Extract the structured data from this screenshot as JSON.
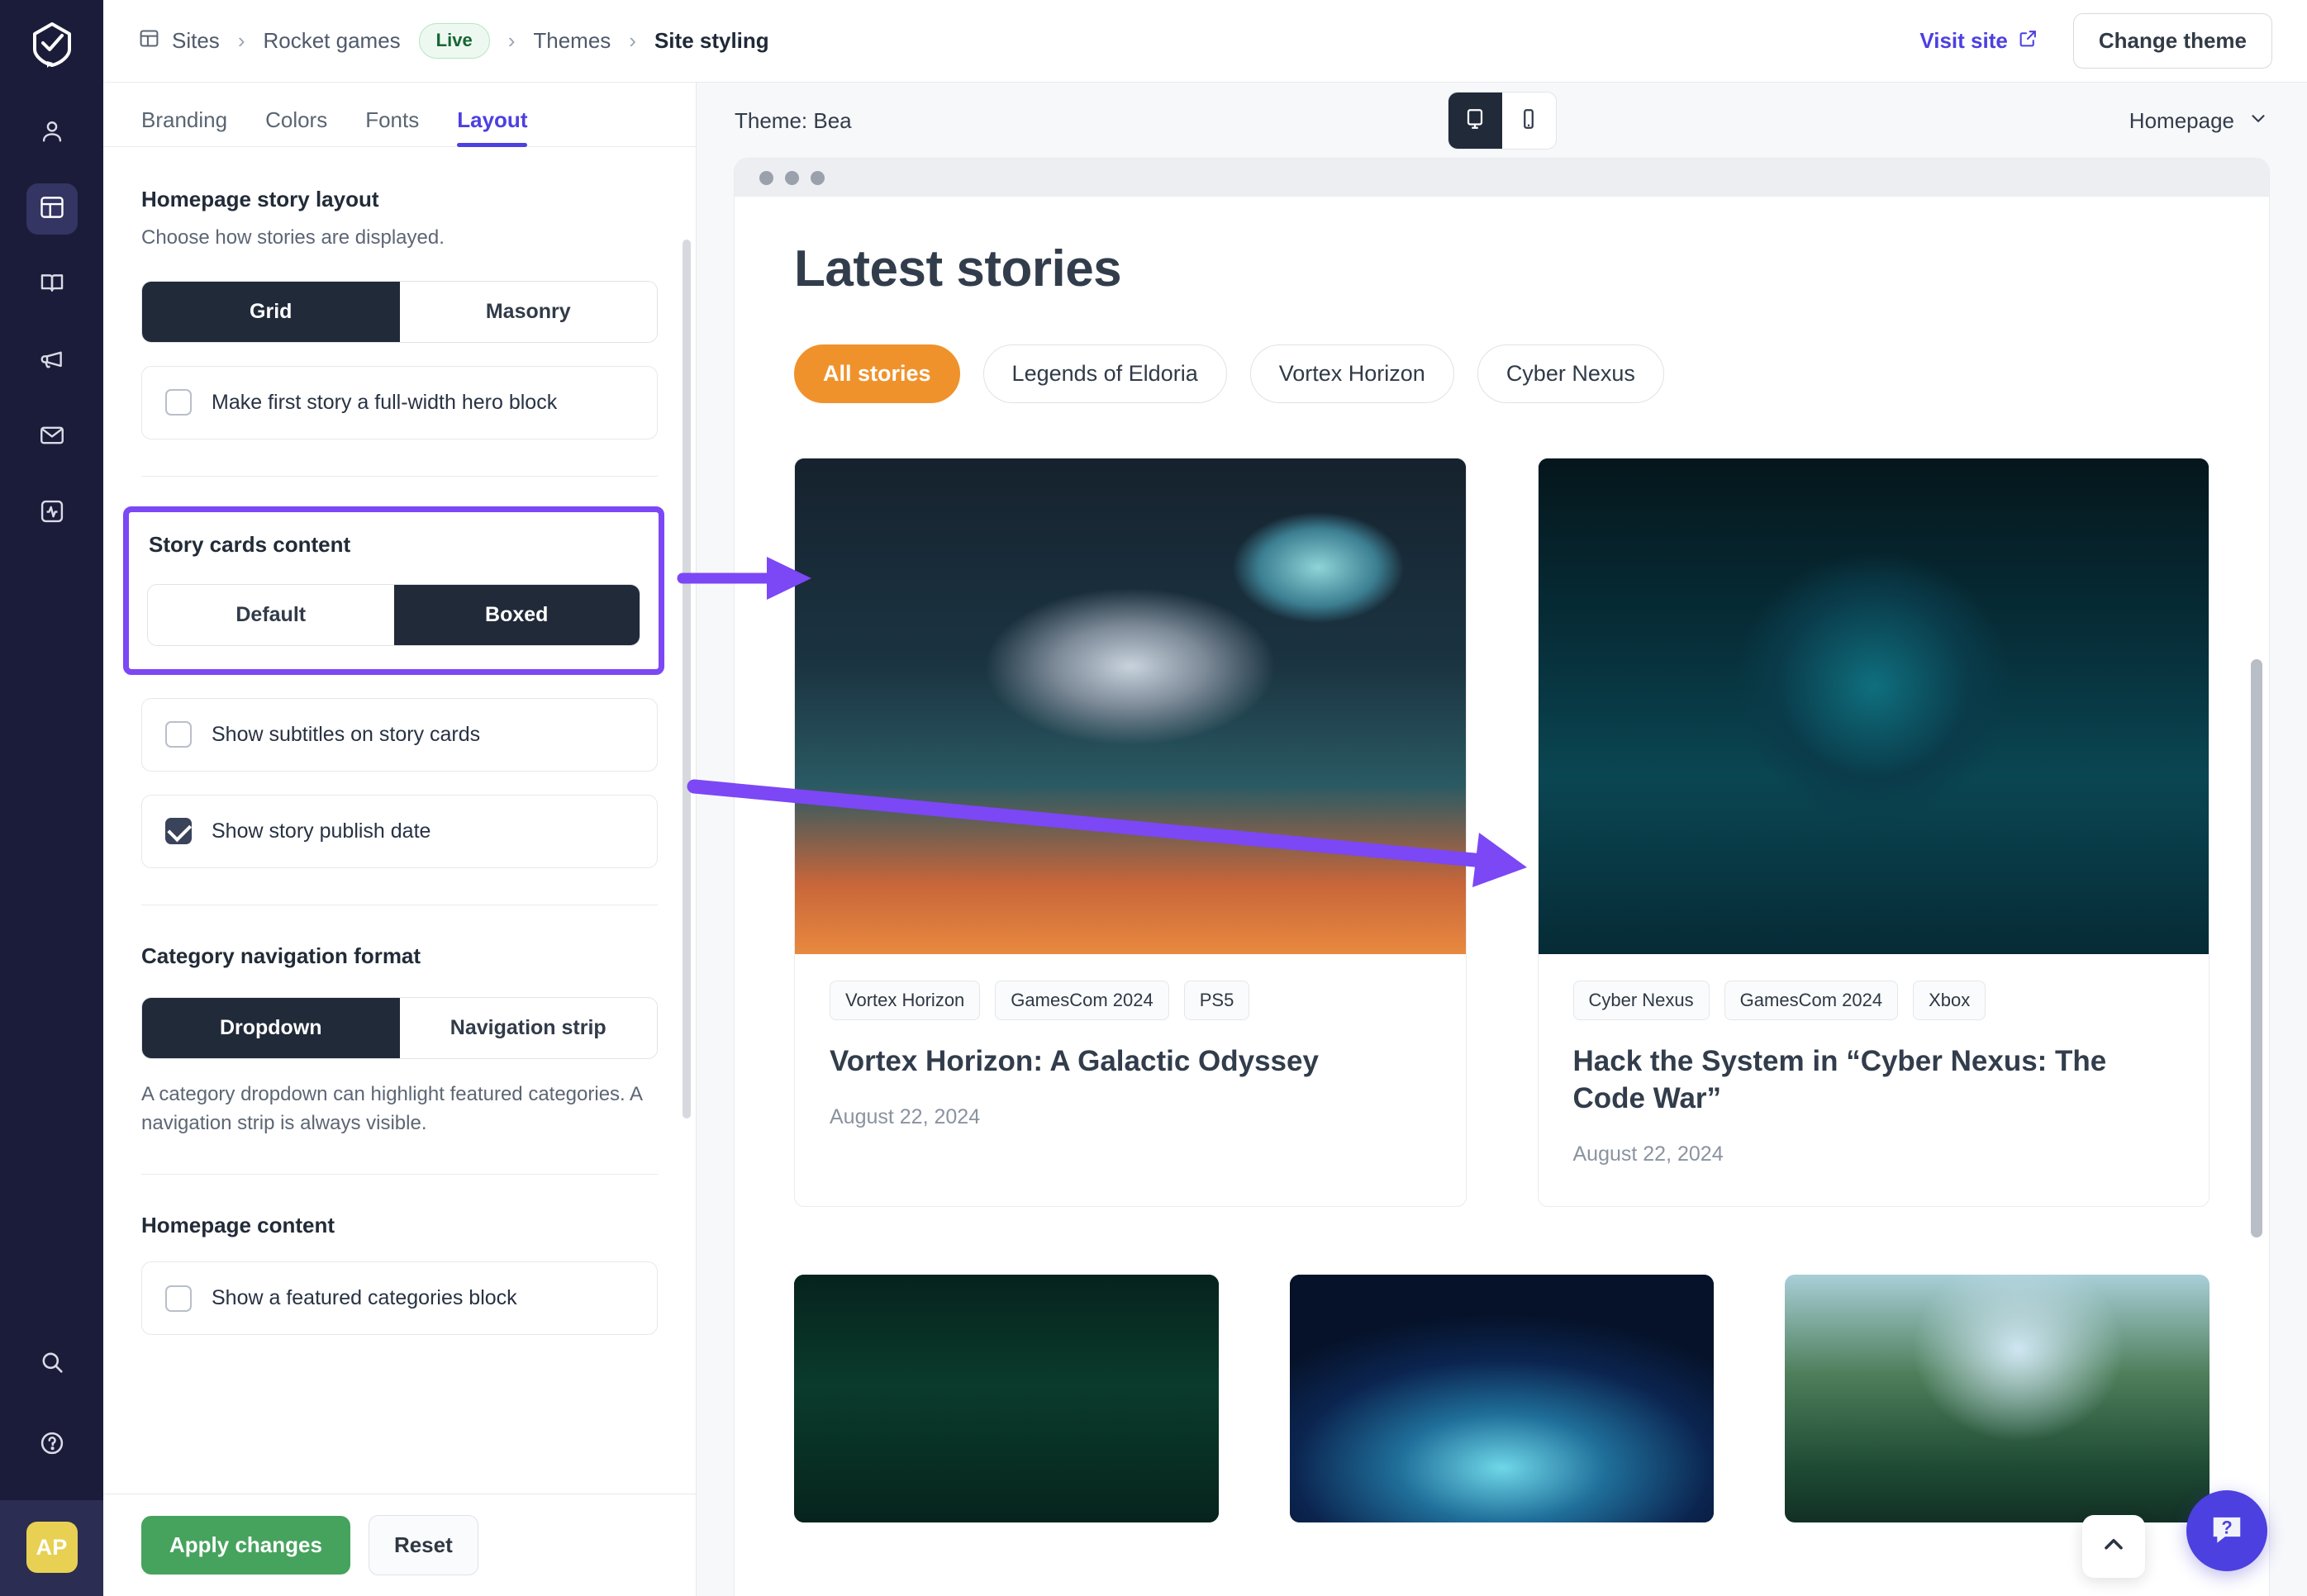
{
  "app": {
    "logo_icon": "spark-logo-icon",
    "avatar_initials": "AP"
  },
  "rail": {
    "items": [
      {
        "name": "account-icon",
        "label": "Account"
      },
      {
        "name": "sites-icon",
        "label": "Sites",
        "active": true
      },
      {
        "name": "book-icon",
        "label": "Docs"
      },
      {
        "name": "megaphone-icon",
        "label": "Announcements"
      },
      {
        "name": "mail-icon",
        "label": "Mail"
      },
      {
        "name": "activity-icon",
        "label": "Activity"
      }
    ],
    "bottom": [
      {
        "name": "search-icon",
        "label": "Search"
      },
      {
        "name": "help-circle-icon",
        "label": "Help"
      }
    ]
  },
  "topbar": {
    "breadcrumbs": [
      {
        "label": "Sites",
        "icon": "layout-icon"
      },
      {
        "label": "Rocket games",
        "badge": "Live"
      },
      {
        "label": "Themes"
      },
      {
        "label": "Site styling",
        "current": true
      }
    ],
    "visit_site_label": "Visit site",
    "visit_site_icon": "external-link-icon",
    "change_theme_label": "Change theme"
  },
  "panel": {
    "tabs": [
      {
        "label": "Branding",
        "active": false
      },
      {
        "label": "Colors",
        "active": false
      },
      {
        "label": "Fonts",
        "active": false
      },
      {
        "label": "Layout",
        "active": true
      }
    ],
    "sections": {
      "homepage_story_layout": {
        "title": "Homepage story layout",
        "description": "Choose how stories are displayed.",
        "segment": {
          "options": [
            "Grid",
            "Masonry"
          ],
          "selected": "Grid"
        },
        "checkbox": {
          "label": "Make first story a full-width hero block",
          "checked": false
        }
      },
      "story_cards_content": {
        "title": "Story cards content",
        "highlighted": true,
        "segment": {
          "options": [
            "Default",
            "Boxed"
          ],
          "selected": "Boxed"
        },
        "checkboxes": [
          {
            "label": "Show subtitles on story cards",
            "checked": false
          },
          {
            "label": "Show story publish date",
            "checked": true
          }
        ]
      },
      "category_navigation_format": {
        "title": "Category navigation format",
        "segment": {
          "options": [
            "Dropdown",
            "Navigation strip"
          ],
          "selected": "Dropdown"
        },
        "description": "A category dropdown can highlight featured categories. A navigation strip is always visible."
      },
      "homepage_content": {
        "title": "Homepage content",
        "checkbox": {
          "label": "Show a featured categories block",
          "checked": false
        }
      }
    },
    "footer": {
      "apply_label": "Apply changes",
      "reset_label": "Reset"
    }
  },
  "preview": {
    "theme_label": "Theme: Bea",
    "devices": [
      {
        "name": "desktop-icon",
        "active": true
      },
      {
        "name": "mobile-icon",
        "active": false
      }
    ],
    "page_selector": {
      "label": "Homepage",
      "icon": "chevron-down-icon"
    },
    "site": {
      "heading": "Latest stories",
      "category_pills": [
        {
          "label": "All stories",
          "active": true
        },
        {
          "label": "Legends of Eldoria",
          "active": false
        },
        {
          "label": "Vortex Horizon",
          "active": false
        },
        {
          "label": "Cyber Nexus",
          "active": false
        }
      ],
      "stories": [
        {
          "tags": [
            "Vortex Horizon",
            "GamesCom 2024",
            "PS5"
          ],
          "title": "Vortex Horizon: A Galactic Odyssey",
          "date": "August 22, 2024",
          "art": "art1"
        },
        {
          "tags": [
            "Cyber Nexus",
            "GamesCom 2024",
            "Xbox"
          ],
          "title": "Hack the System in “Cyber Nexus: The Code War”",
          "date": "August 22, 2024",
          "art": "art2"
        }
      ],
      "stories_row2": [
        {
          "art": "art3"
        },
        {
          "art": "art4"
        },
        {
          "art": "art5"
        }
      ]
    },
    "scroll_top_icon": "chevron-up-icon",
    "help_fab_icon": "help-chat-icon"
  },
  "colors": {
    "accent_purple": "#4c40e0",
    "annotation_purple": "#7c47f5",
    "dark_nav": "#1b1c3a",
    "segment_active": "#212a39",
    "pill_active_orange": "#f0922b",
    "apply_green": "#46a35e",
    "live_badge_green": "#166534",
    "avatar_yellow": "#e8d053"
  }
}
